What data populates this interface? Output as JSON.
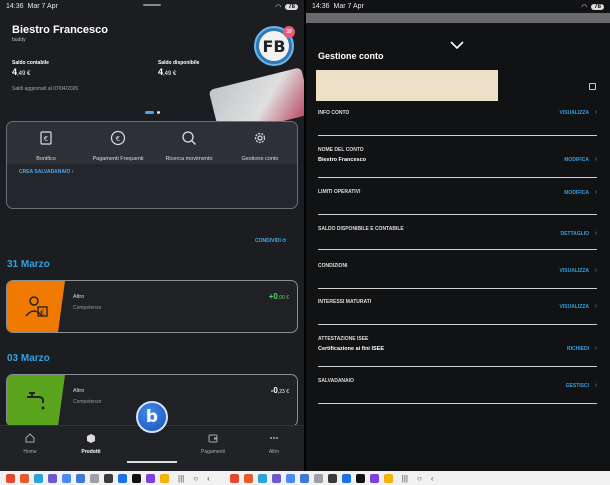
{
  "status_bar": {
    "time": "14:36",
    "date": "Mar 7 Apr",
    "battery": "78"
  },
  "left": {
    "user_name": "Biestro Francesco",
    "user_sub": "buddy",
    "avatar_initials": "FB",
    "notification_count": "39",
    "saldo_contabile_label": "Saldo contabile",
    "saldo_contabile_int": "4",
    "saldo_contabile_dec": ",49 €",
    "saldo_disponibile_label": "Saldo disponibile",
    "saldo_disponibile_int": "4",
    "saldo_disponibile_dec": ",49 €",
    "updated_text": "Saldi aggiornati al 07/04/2026",
    "actions": [
      {
        "label": "Bonifico",
        "icon": "euro-doc-icon"
      },
      {
        "label": "Pagamenti Frequenti",
        "icon": "euro-cycle-icon"
      },
      {
        "label": "Ricerca movimento",
        "icon": "search-icon"
      },
      {
        "label": "Gestione conto",
        "icon": "gear-icon"
      }
    ],
    "crea_salvadanaio": "CREA SALVADANAIO",
    "condividi": "CONDIVIDI",
    "groups": [
      {
        "date": "31 Marzo",
        "title": "Altro",
        "sub": "Competenze",
        "amount_int": "+0",
        "amount_dec": ",00 €",
        "color": "#f07a00"
      },
      {
        "date": "03 Marzo",
        "title": "Altro",
        "sub": "Competenze",
        "amount_int": "-0",
        "amount_dec": ",23 €",
        "color": "#5ba51e"
      }
    ],
    "nav": [
      {
        "label": "Home",
        "icon": "home-icon"
      },
      {
        "label": "Prodotti",
        "icon": "box-icon"
      },
      {
        "label": "Pagamenti",
        "icon": "wallet-icon"
      },
      {
        "label": "Altro",
        "icon": "more-icon"
      }
    ],
    "fab_letter": "b"
  },
  "right": {
    "title": "Gestione conto",
    "rows": [
      {
        "heading": "INFO CONTO",
        "value": "",
        "action": "VISUALIZZA"
      },
      {
        "heading": "NOME DEL CONTO",
        "value": "Biestro Francesco",
        "action": "MODIFICA"
      },
      {
        "heading": "LIMITI OPERATIVI",
        "value": "",
        "action": "MODIFICA"
      },
      {
        "heading": "SALDO DISPONIBILE E CONTABILE",
        "value": "",
        "action": "DETTAGLIO"
      },
      {
        "heading": "CONDIZIONI",
        "value": "",
        "action": "VISUALIZZA"
      },
      {
        "heading": "INTERESSI MATURATI",
        "value": "",
        "action": "VISUALIZZA"
      },
      {
        "heading": "ATTESTAZIONE ISEE",
        "value": "Certificazione ai fini ISEE",
        "action": "RICHIEDI"
      },
      {
        "heading": "SALVADANAIO",
        "value": "",
        "action": "GESTISCI"
      }
    ]
  },
  "sys_apps_colors": [
    "#e54b2a",
    "#ea5a2c",
    "#2aa3d8",
    "#6a5acd",
    "#4b8bf5",
    "#3e7ad6",
    "#9aa0a6",
    "#3a3a3a",
    "#1a73e8",
    "#111111",
    "#7b3fe4",
    "#f2b400"
  ]
}
